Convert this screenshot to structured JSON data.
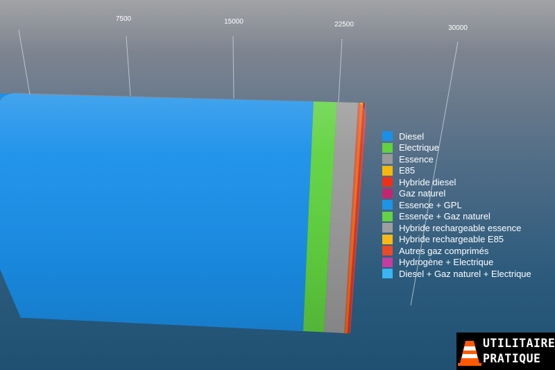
{
  "chart_data": {
    "type": "bar",
    "orientation": "horizontal",
    "stacked": true,
    "three_d": true,
    "x_ticks": [
      7500,
      15000,
      22500,
      30000
    ],
    "x_tick_labels": [
      "7500",
      "15000",
      "22500",
      "30000"
    ],
    "legend_position": "right",
    "series": [
      {
        "name": "Diesel",
        "color": "#1a90ea",
        "value": 21000
      },
      {
        "name": "Electrique",
        "color": "#61d240",
        "value": 1000
      },
      {
        "name": "Essence",
        "color": "#9a9a9a",
        "value": 1000
      },
      {
        "name": "E85",
        "color": "#f5b80a",
        "value": 120
      },
      {
        "name": "Hybride diesel",
        "color": "#ee2f17",
        "value": 50
      },
      {
        "name": "Gaz naturel",
        "color": "#c3266f",
        "value": 40
      },
      {
        "name": "Essence + GPL",
        "color": "#1d95e4",
        "value": 20
      },
      {
        "name": "Essence + Gaz naturel",
        "color": "#65d147",
        "value": 5
      },
      {
        "name": "Hybride rechargeable essence",
        "color": "#9e9e9e",
        "value": 5
      },
      {
        "name": "Hybride rechargeable E85",
        "color": "#f7b817",
        "value": 5
      },
      {
        "name": "Autres gaz comprimés",
        "color": "#e84a27",
        "value": 5
      },
      {
        "name": "Hydrogène + Electrique",
        "color": "#c43da0",
        "value": 5
      },
      {
        "name": "Diesel + Gaz naturel + Electrique",
        "color": "#3ab4f2",
        "value": 5
      }
    ]
  },
  "logo": {
    "line1": "UTILITAIRE",
    "line2": "PRATIQUE"
  }
}
